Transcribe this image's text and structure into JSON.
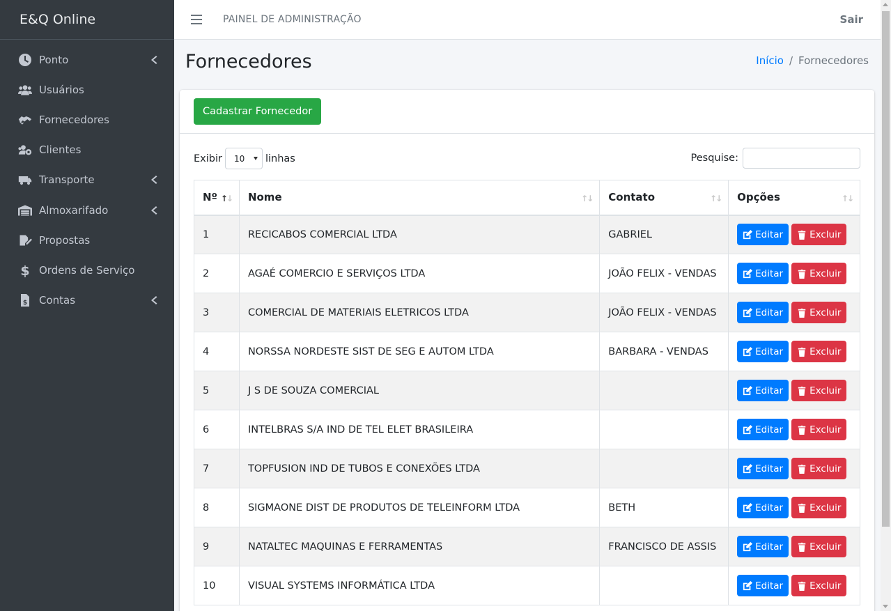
{
  "brand": "E&Q Online",
  "topbar": {
    "title": "PAINEL DE ADMINISTRAÇÃO",
    "logout": "Sair"
  },
  "sidebar": {
    "items": [
      {
        "label": "Ponto",
        "icon": "clock-icon",
        "has_submenu": true
      },
      {
        "label": "Usuários",
        "icon": "users-icon",
        "has_submenu": false
      },
      {
        "label": "Fornecedores",
        "icon": "handshake-icon",
        "has_submenu": false
      },
      {
        "label": "Clientes",
        "icon": "users-cog-icon",
        "has_submenu": false
      },
      {
        "label": "Transporte",
        "icon": "truck-icon",
        "has_submenu": true
      },
      {
        "label": "Almoxarifado",
        "icon": "warehouse-icon",
        "has_submenu": true
      },
      {
        "label": "Propostas",
        "icon": "file-signature-icon",
        "has_submenu": false
      },
      {
        "label": "Ordens de Serviço",
        "icon": "dollar-icon",
        "has_submenu": false
      },
      {
        "label": "Contas",
        "icon": "file-invoice-dollar-icon",
        "has_submenu": true
      }
    ]
  },
  "page": {
    "title": "Fornecedores"
  },
  "breadcrumb": {
    "home": "Início",
    "current": "Fornecedores",
    "separator": "/"
  },
  "actions": {
    "add_label": "Cadastrar Fornecedor"
  },
  "table_controls": {
    "show_prefix": "Exibir",
    "page_length": "10",
    "show_suffix": "linhas",
    "search_label": "Pesquise:",
    "search_value": ""
  },
  "table": {
    "columns": [
      "Nº",
      "Nome",
      "Contato",
      "Opções"
    ],
    "rows": [
      {
        "n": "1",
        "nome": "RECICABOS COMERCIAL LTDA",
        "contato": "GABRIEL"
      },
      {
        "n": "2",
        "nome": "AGAÉ COMERCIO E SERVIÇOS LTDA",
        "contato": "JOÃO FELIX - VENDAS"
      },
      {
        "n": "3",
        "nome": "COMERCIAL DE MATERIAIS ELETRICOS LTDA",
        "contato": "JOÃO FELIX - VENDAS"
      },
      {
        "n": "4",
        "nome": "NORSSA NORDESTE SIST DE SEG E AUTOM LTDA",
        "contato": "BARBARA - VENDAS"
      },
      {
        "n": "5",
        "nome": "J S DE SOUZA COMERCIAL",
        "contato": ""
      },
      {
        "n": "6",
        "nome": "INTELBRAS S/A IND DE TEL ELET BRASILEIRA",
        "contato": ""
      },
      {
        "n": "7",
        "nome": "TOPFUSION IND DE TUBOS E CONEXÕES LTDA",
        "contato": ""
      },
      {
        "n": "8",
        "nome": "SIGMAONE DIST DE PRODUTOS DE TELEINFORM LTDA",
        "contato": "BETH"
      },
      {
        "n": "9",
        "nome": "NATALTEC MAQUINAS E FERRAMENTAS",
        "contato": "FRANCISCO DE ASSIS"
      },
      {
        "n": "10",
        "nome": "VISUAL SYSTEMS INFORMÁTICA LTDA",
        "contato": ""
      }
    ],
    "edit_label": "Editar",
    "delete_label": "Excluir"
  },
  "colors": {
    "sidebar_bg": "#343a40",
    "primary": "#007bff",
    "success": "#28a745",
    "danger": "#dc3545"
  }
}
